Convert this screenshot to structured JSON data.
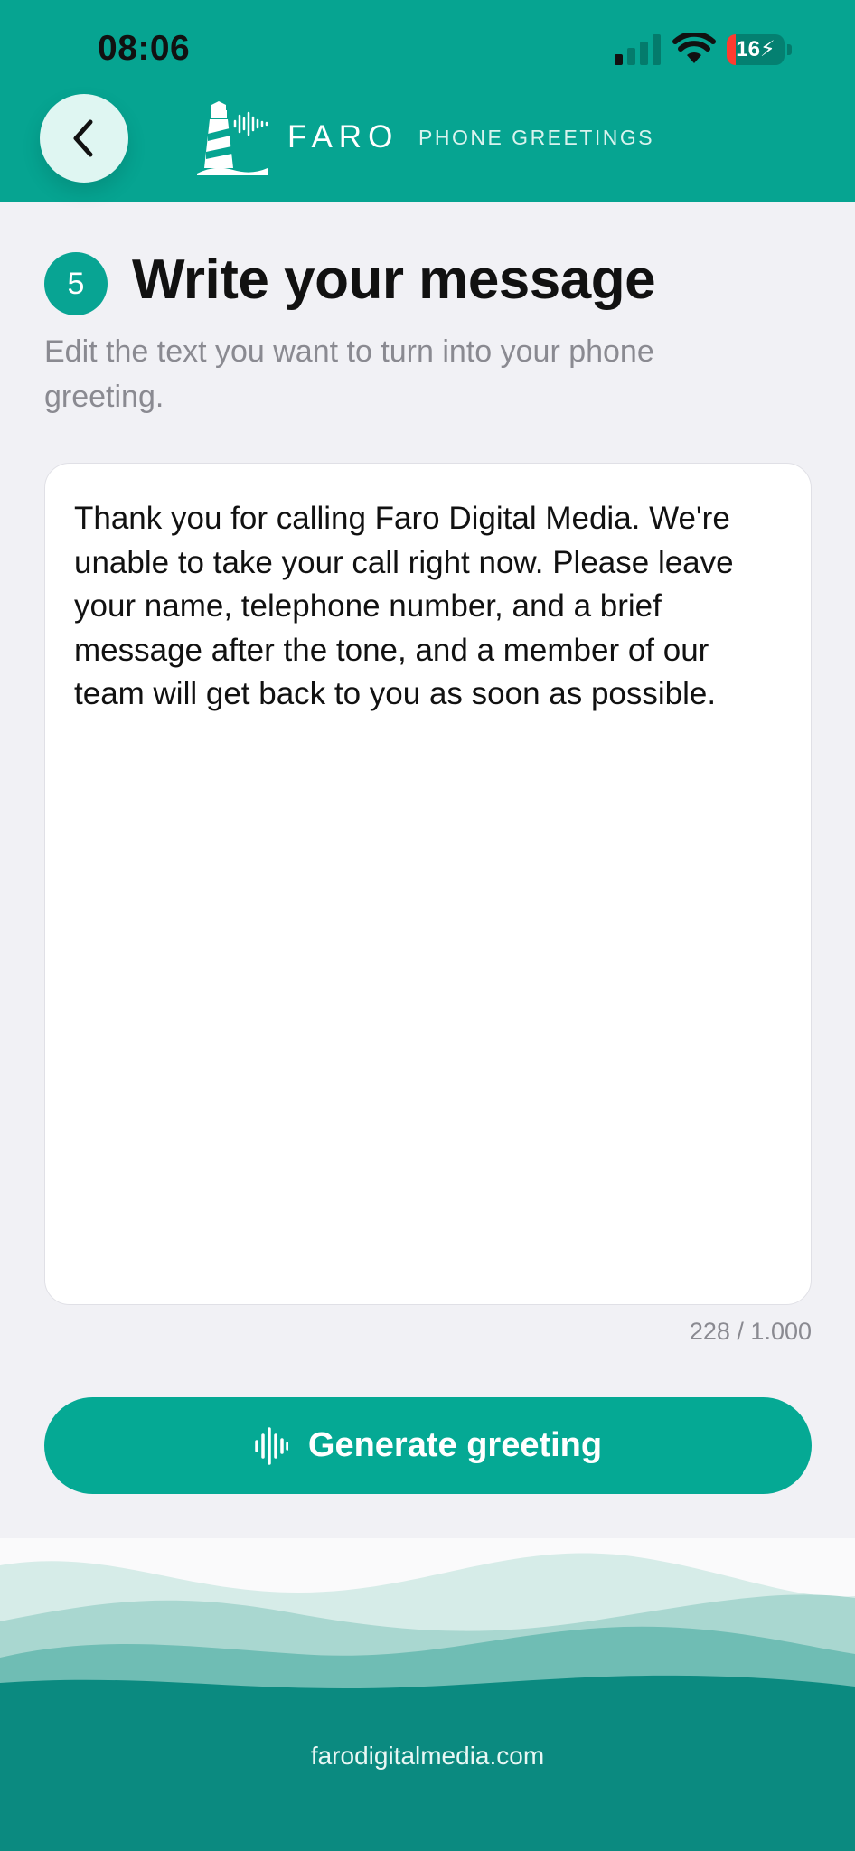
{
  "status_bar": {
    "time": "08:06",
    "battery_level": "16",
    "icons": [
      "signal-icon",
      "wifi-icon",
      "battery-charging-icon"
    ]
  },
  "header": {
    "back_icon": "chevron-left-icon",
    "logo_icon": "lighthouse-icon",
    "brand_name": "FARO",
    "brand_subtitle": "PHONE GREETINGS"
  },
  "step": {
    "number": "5",
    "title": "Write your message",
    "subtitle": "Edit the text you want to turn into your phone greeting."
  },
  "message": {
    "value": "Thank you for calling Faro Digital Media. We're unable to take your call right now. Please leave your name, telephone number, and a brief message after the tone, and a member of our team will get back to you as soon as possible.",
    "counter": "228 / 1.000"
  },
  "actions": {
    "generate_label": "Generate greeting",
    "generate_icon": "sound-wave-icon"
  },
  "footer": {
    "website": "farodigitalmedia.com"
  },
  "colors": {
    "brand_teal": "#06a491",
    "footer_teal": "#0b8a80",
    "background": "#f1f1f5"
  }
}
